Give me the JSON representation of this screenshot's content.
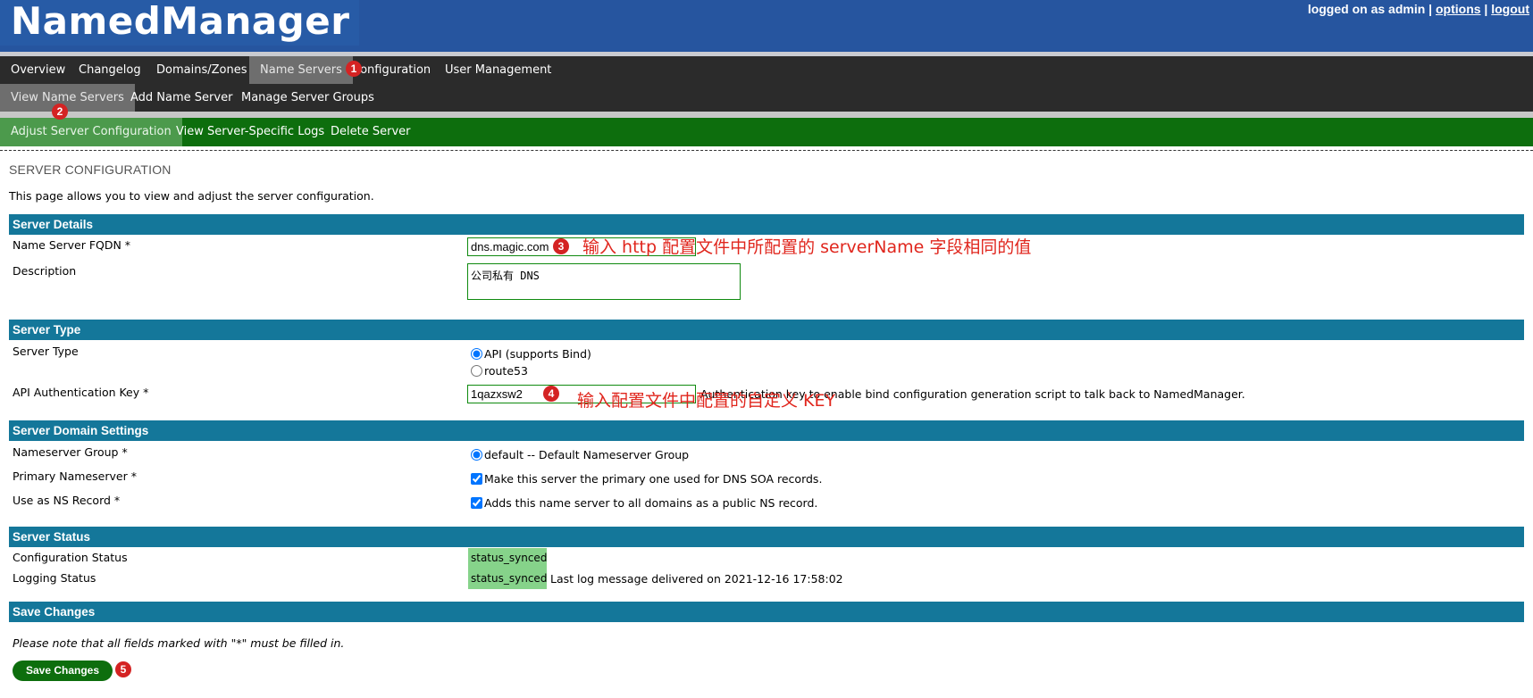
{
  "app": {
    "title": "NamedManager"
  },
  "header": {
    "logged_prefix": "logged on as admin",
    "sep1": "|",
    "sep2": "|",
    "options": "options",
    "logout": "logout"
  },
  "nav_main": [
    {
      "label": "Overview",
      "active": false
    },
    {
      "label": "Changelog",
      "active": false
    },
    {
      "label": "Domains/Zones",
      "active": false
    },
    {
      "label": "Name Servers",
      "active": true
    },
    {
      "label": "Configuration",
      "active": false
    },
    {
      "label": "User Management",
      "active": false
    }
  ],
  "nav_sub": [
    {
      "label": "View Name Servers",
      "active": true
    },
    {
      "label": "Add Name Server",
      "active": false
    },
    {
      "label": "Manage Server Groups",
      "active": false
    }
  ],
  "nav_server": [
    {
      "label": "Adjust Server Configuration",
      "active": true
    },
    {
      "label": "View Server-Specific Logs",
      "active": false
    },
    {
      "label": "Delete Server",
      "active": false
    }
  ],
  "page": {
    "title": "SERVER CONFIGURATION",
    "description": "This page allows you to view and adjust the server configuration."
  },
  "sections": {
    "details": "Server Details",
    "type": "Server Type",
    "domain": "Server Domain Settings",
    "status": "Server Status",
    "save": "Save Changes"
  },
  "details": {
    "fqdn_label": "Name Server FQDN *",
    "fqdn_value": "dns.magic.com",
    "description_label": "Description",
    "description_value": "公司私有 DNS"
  },
  "server_type": {
    "label": "Server Type",
    "option_api": "API (supports Bind)",
    "option_route53": "route53",
    "selected": "api",
    "key_label": "API Authentication Key *",
    "key_value": "1qazxsw2",
    "key_help": "Authentication key to enable bind configuration generation script to talk back to NamedManager."
  },
  "domain_settings": {
    "group_label": "Nameserver Group *",
    "group_option": "default -- Default Nameserver Group",
    "primary_label": "Primary Nameserver *",
    "primary_text": "Make this server the primary one used for DNS SOA records.",
    "ns_label": "Use as NS Record *",
    "ns_text": "Adds this name server to all domains as a public NS record."
  },
  "status": {
    "config_label": "Configuration Status",
    "config_value": "status_synced",
    "logging_label": "Logging Status",
    "logging_value": "status_synced",
    "log_message": "Last log message delivered on 2021-12-16 17:58:02"
  },
  "save": {
    "note": "Please note that all fields marked with \"*\" must be filled in.",
    "button": "Save Changes"
  },
  "annotations": {
    "b1": "1",
    "b2": "2",
    "b3": "3",
    "b4": "4",
    "b5": "5",
    "note3": "输入 http 配置文件中所配置的 serverName 字段相同的值",
    "note4": "输入配置文件中配置的自定义 KEY"
  },
  "colors": {
    "header_bg": "#26559f",
    "nav_bg": "#2b2b2b",
    "nav_green": "#0d6e0d",
    "section_bar": "#14779a",
    "status_green": "#86d38a",
    "annotation_red": "#e0261d"
  }
}
